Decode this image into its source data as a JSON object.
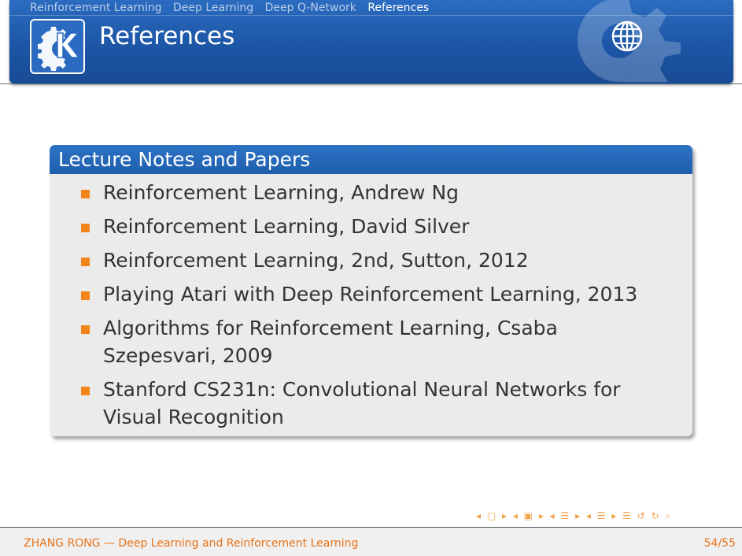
{
  "header": {
    "nav_sections": [
      "Reinforcement Learning",
      "Deep Learning",
      "Deep Q-Network",
      "References"
    ],
    "active_section": "References",
    "title": "References",
    "logo_letter": "K"
  },
  "block": {
    "title": "Lecture Notes and Papers",
    "items": [
      "Reinforcement Learning, Andrew Ng",
      "Reinforcement Learning, David Silver",
      "Reinforcement Learning, 2nd, Sutton, 2012",
      "Playing Atari with Deep Reinforcement Learning, 2013",
      "Algorithms for Reinforcement Learning, Csaba Szepesvari, 2009",
      "Stanford CS231n: Convolutional Neural Networks for Visual Recognition"
    ]
  },
  "footer": {
    "left": "ZHANG RONG — Deep Learning and Reinforcement Learning",
    "page": "54/55"
  },
  "colors": {
    "header_blue": "#1d56a6",
    "accent_orange": "#f28519",
    "footer_text": "#e8731a"
  },
  "icons": [
    "kde-logo-icon",
    "globe-icon",
    "gear-watermark-icon",
    "beamer-navigation-icons"
  ]
}
